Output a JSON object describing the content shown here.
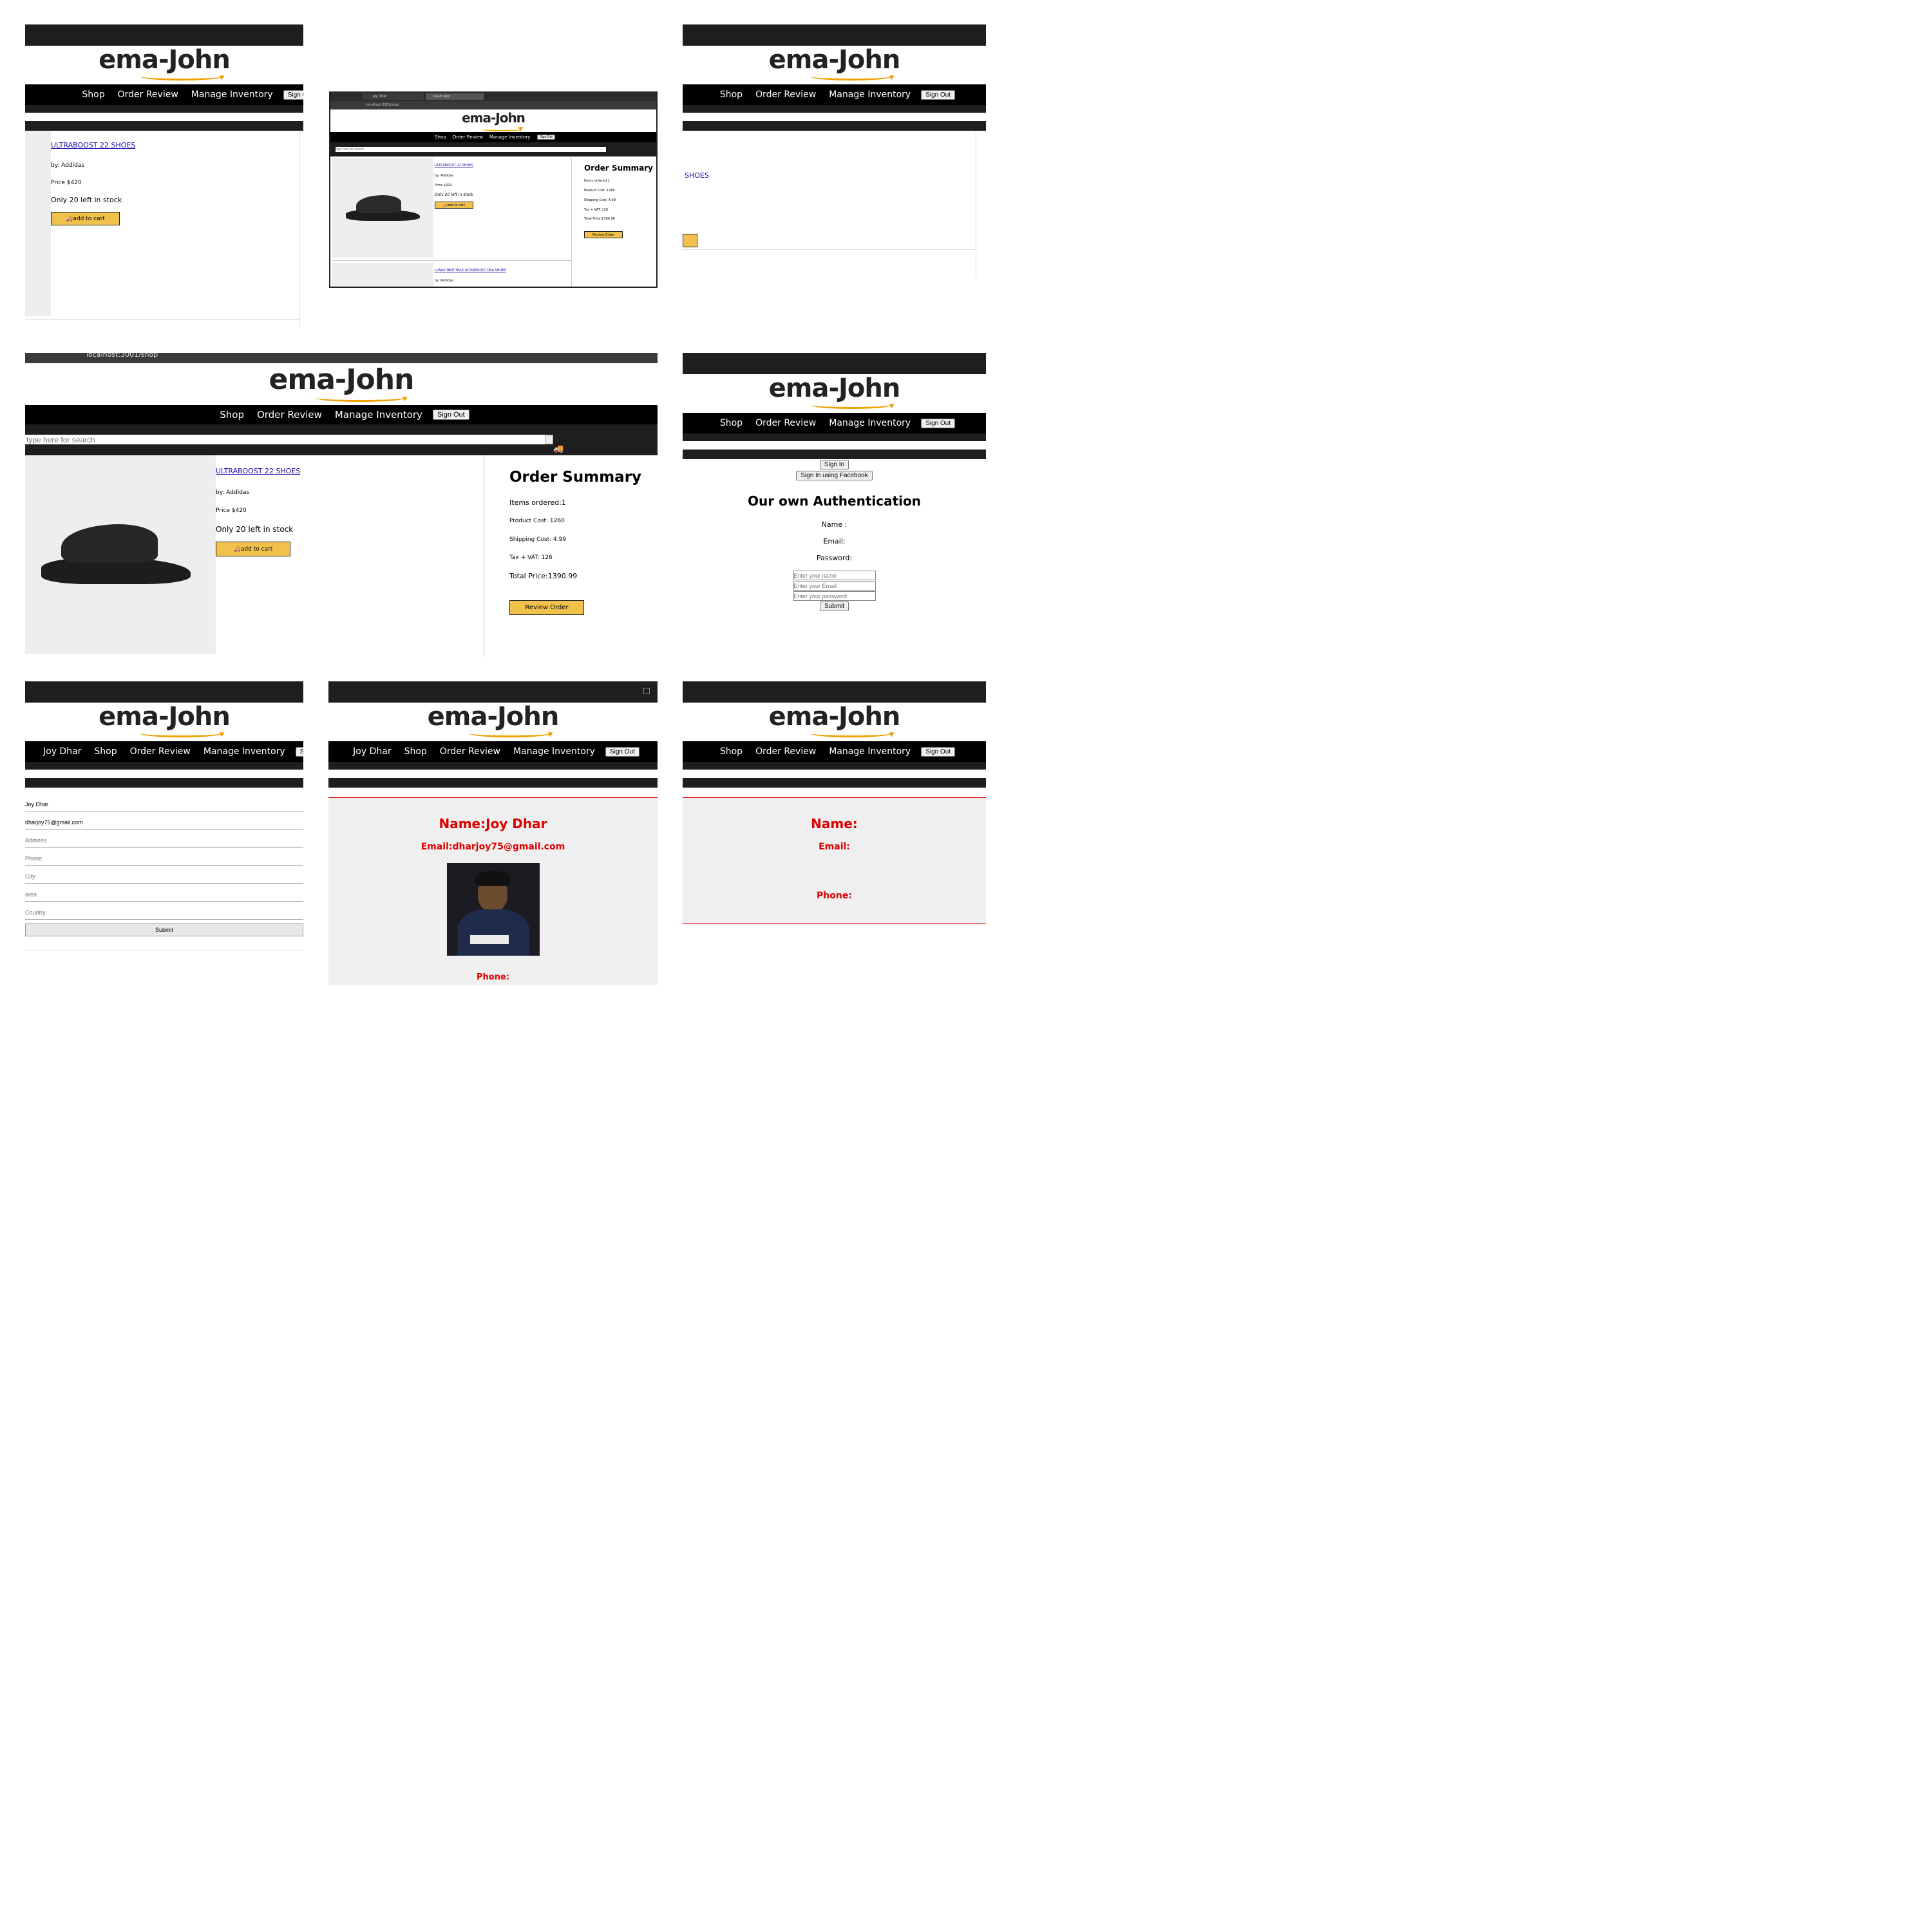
{
  "brand": "ema-John",
  "nav": {
    "shop": "Shop",
    "order_review": "Order Review",
    "manage_inventory": "Manage Inventory",
    "sign_out": "Sign Out",
    "user": "Joy Dhar"
  },
  "product": {
    "name": "ULTRABOOST 22 SHOES",
    "partial_name": "SHOES",
    "by": "by: Addidas",
    "price": "Price $420",
    "stock": "Only 20 left in stock",
    "add_to_cart": "add to cart"
  },
  "product2": {
    "name": "LUNAR NEW YEAR ULTRABOOST DNA SHOES",
    "by": "by: Addidas"
  },
  "search": {
    "placeholder": "type here for search"
  },
  "summary": {
    "title": "Order Summary",
    "items": "Items ordered:1",
    "product_cost": "Product Cost: 1260",
    "shipping": "Shipping Cost: 4.99",
    "tax": "Tax + VAT: 126",
    "total": "Total Price:1390.99",
    "review_btn": "Review Order"
  },
  "browser": {
    "tab1": "Joy Dhar",
    "tab2": "React App",
    "url": "localhost:3001/shop"
  },
  "auth": {
    "sign_in": "Sign In",
    "sign_in_fb": "Sign In using Facebook",
    "title": "Our own Authentication",
    "name_label": "Name :",
    "email_label": "Email:",
    "password_label": "Password:",
    "name_ph": "Enter your name",
    "email_ph": "Enter your Email",
    "password_ph": "Enter your password",
    "submit": "Submit"
  },
  "shipment": {
    "name": "Joy Dhar",
    "email": "dharjoy75@gmail.com",
    "address_ph": "Address",
    "phone_ph": "Phone",
    "city_ph": "City",
    "area_ph": "area",
    "country_ph": "Country",
    "submit": "Submit"
  },
  "profile": {
    "name": "Name:Joy Dhar",
    "email": "Email:dharjoy75@gmail.com",
    "phone": "Phone:"
  },
  "profile_empty": {
    "name": "Name:",
    "email": "Email:",
    "phone": "Phone:"
  },
  "colors": {
    "accent": "#f0c14b",
    "nav_bg": "#000000",
    "dark_bar": "#1e1e1e",
    "profile_red": "#e00000",
    "link": "#1a0dab"
  }
}
